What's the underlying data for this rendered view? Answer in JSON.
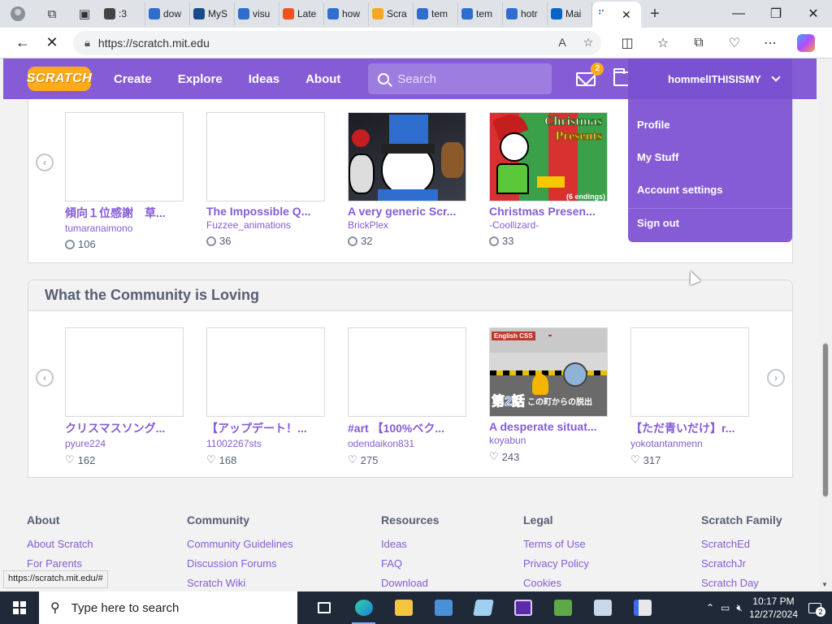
{
  "browser": {
    "tabs": [
      {
        "label": ":3",
        "color": "#444"
      },
      {
        "label": "dow",
        "color": "#2f6ecf"
      },
      {
        "label": "MyS",
        "color": "#1a4a8a"
      },
      {
        "label": "visu",
        "color": "#2f6ecf"
      },
      {
        "label": "Late",
        "color": "#f25022"
      },
      {
        "label": "how",
        "color": "#2f6ecf"
      },
      {
        "label": "Scra",
        "color": "#f5a623"
      },
      {
        "label": "tem",
        "color": "#2f6ecf"
      },
      {
        "label": "tem",
        "color": "#2f6ecf"
      },
      {
        "label": "hotr",
        "color": "#2f6ecf"
      },
      {
        "label": "Mai",
        "color": "#0a64c8"
      }
    ],
    "url": "https://scratch.mit.edu",
    "status_url": "https://scratch.mit.edu/#"
  },
  "scratch": {
    "logo": "SCRATCH",
    "nav": [
      "Create",
      "Explore",
      "Ideas",
      "About"
    ],
    "search_placeholder": "Search",
    "messages_count": "2",
    "username": "hommelITHISISMY",
    "dropdown": [
      "Profile",
      "My Stuff",
      "Account settings",
      "Sign out"
    ]
  },
  "row1": [
    {
      "title": "傾向１位感謝　草...",
      "author": "tumaranaimono",
      "stat": "106"
    },
    {
      "title": "The Impossible Q...",
      "author": "Fuzzee_animations",
      "stat": "36"
    },
    {
      "title": "A very generic Scr...",
      "author": "BrickPlex",
      "stat": "32"
    },
    {
      "title": "Christmas Presen...",
      "author": "-Coollizard-",
      "stat": "33"
    }
  ],
  "row1_thumb_texts": {
    "christmas_line1": "Christmas",
    "christmas_line2": "Presents",
    "christmas_endings": "(6 endings)"
  },
  "community": {
    "heading": "What the Community is Loving",
    "projects": [
      {
        "title": "クリスマスソング...",
        "author": "pyure224",
        "stat": "162"
      },
      {
        "title": "【アップデート！...",
        "author": "11002267sts",
        "stat": "168"
      },
      {
        "title": "#art 【100%ベク...",
        "author": "odendaikon831",
        "stat": "275"
      },
      {
        "title": "A desperate situat...",
        "author": "koyabun",
        "stat": "243"
      },
      {
        "title": "【ただ青いだけ】r...",
        "author": "yokotantanmenn",
        "stat": "317"
      }
    ],
    "thumb_texts": {
      "tag": "English CSS",
      "big": "第2話",
      "sub": "この町からの脱出"
    }
  },
  "footer": [
    {
      "heading": "About",
      "links": [
        "About Scratch",
        "For Parents"
      ]
    },
    {
      "heading": "Community",
      "links": [
        "Community Guidelines",
        "Discussion Forums",
        "Scratch Wiki"
      ]
    },
    {
      "heading": "Resources",
      "links": [
        "Ideas",
        "FAQ",
        "Download"
      ]
    },
    {
      "heading": "Legal",
      "links": [
        "Terms of Use",
        "Privacy Policy",
        "Cookies"
      ]
    },
    {
      "heading": "Scratch Family",
      "links": [
        "ScratchEd",
        "ScratchJr",
        "Scratch Day"
      ]
    }
  ],
  "taskbar": {
    "search_placeholder": "Type here to search",
    "time": "10:17 PM",
    "date": "12/27/2024",
    "notifications": "2"
  }
}
